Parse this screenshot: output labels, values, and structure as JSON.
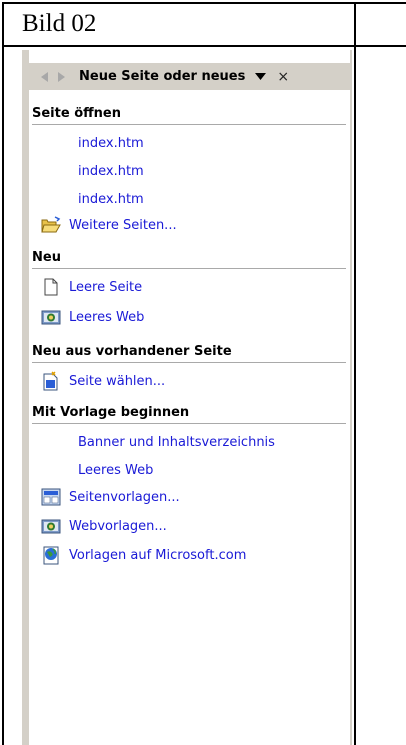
{
  "caption": "Bild 02",
  "pane": {
    "title": "Neue Seite oder neues",
    "back_icon": "back-arrow-icon",
    "forward_icon": "forward-arrow-icon",
    "dropdown_icon": "chevron-down-icon",
    "close_label": "×"
  },
  "sections": {
    "open": {
      "heading": "Seite öffnen",
      "items": [
        "index.htm",
        "index.htm",
        "index.htm"
      ],
      "more": "Weitere Seiten..."
    },
    "new": {
      "heading": "Neu",
      "blank_page": "Leere Seite",
      "blank_web": "Leeres Web"
    },
    "from_existing": {
      "heading": "Neu aus vorhandener Seite",
      "choose_page": "Seite wählen..."
    },
    "template": {
      "heading": "Mit Vorlage beginnen",
      "recent": [
        "Banner und Inhaltsverzeichnis",
        "Leeres Web"
      ],
      "page_templates": "Seitenvorlagen...",
      "web_templates": "Webvorlagen...",
      "ms_templates": "Vorlagen auf Microsoft.com"
    }
  }
}
